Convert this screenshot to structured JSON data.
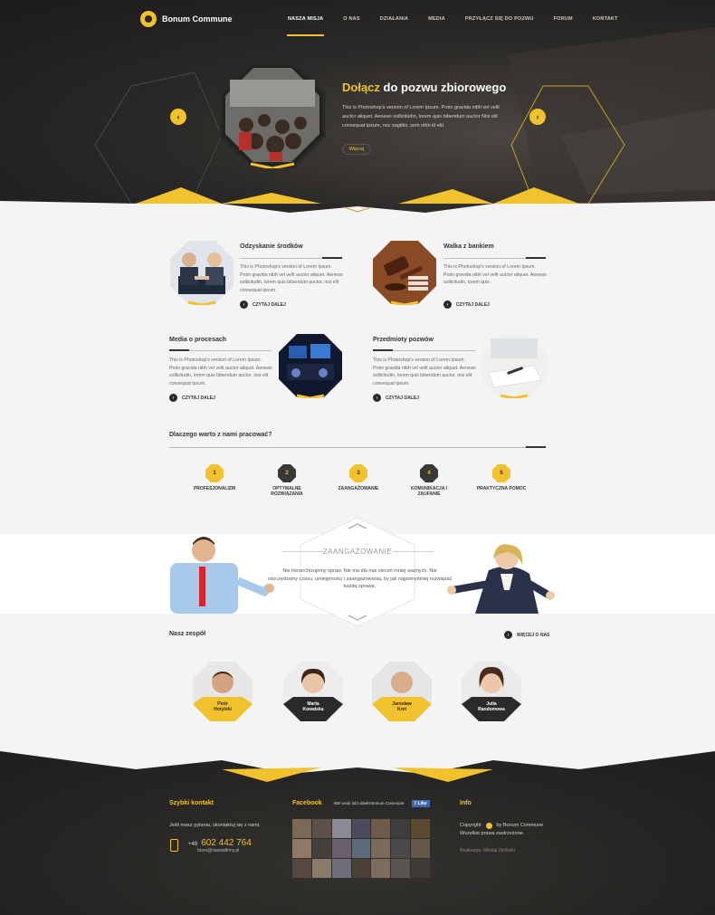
{
  "brand": {
    "name": "Bonum Commune",
    "accent": "#f2c12e",
    "dark": "#2b2a28"
  },
  "nav": [
    {
      "label": "NASZA MISJA",
      "active": true
    },
    {
      "label": "O NAS"
    },
    {
      "label": "DZIAŁANIA"
    },
    {
      "label": "MEDIA"
    },
    {
      "label": "PRZYŁĄCZ SIĘ DO POZWU"
    },
    {
      "label": "FORUM"
    },
    {
      "label": "KONTAKT"
    }
  ],
  "hero": {
    "title_accent": "Dołącz",
    "title_rest": " do pozwu zbiorowego",
    "text": "This is Photoshop's version  of Lorem Ipsum. Proin gravida nibh vel velit auctor aliquet. Aenean sollicitudin, lorem quis bibendum auctor Nisi elit consequat ipsum, nec sagittis, sem nibh id elit.",
    "button": "Więcej",
    "prev_icon": "chevron-left-icon",
    "next_icon": "chevron-right-icon"
  },
  "services": [
    {
      "title": "Odzyskanie środków",
      "text": "This is Photoshop's version  of Lorem Ipsum. Proin gravida nibh vel velit auctor aliquet. Aenean sollicitudin, lorem quis bibendum auctor, nisi elit consequat ipsum.",
      "link": "CZYTAJ DALEJ"
    },
    {
      "title": "Walka z bankiem",
      "text": "This is Photoshop's version  of Lorem Ipsum. Proin gravida nibh vel velit auctor aliquet. Aenean sollicitudin, lorem quis.",
      "link": "CZYTAJ DALEJ"
    },
    {
      "title": "Media o procesach",
      "text": "This is Photoshop's version  of Lorem Ipsum. Proin gravida nibh vel velit auctor aliquet. Aenean sollicitudin, lorem quis bibendum auctor, nisi elit consequat ipsum.",
      "link": "CZYTAJ DALEJ"
    },
    {
      "title": "Przedmioty pozwów",
      "text": "This is Photoshop's version  of Lorem Ipsum. Proin gravida nibh vel velit auctor aliquet. Aenean sollicitudin, lorem quis bibendum auctor, nisi elit consequat ipsum.",
      "link": "CZYTAJ DALEJ"
    }
  ],
  "why": {
    "title": "Dlaczego warto z nami pracować?",
    "items": [
      {
        "num": "1",
        "label": "PROFESJONALIZM"
      },
      {
        "num": "2",
        "label": "OPTYMALNE ROZWIĄZANIA"
      },
      {
        "num": "3",
        "label": "ZAANGAŻOWANIE"
      },
      {
        "num": "4",
        "label": "KOMUNIKACJA I ZAUFANIE"
      },
      {
        "num": "5",
        "label": "PRAKTYCZNA POMOC"
      }
    ]
  },
  "commitment": {
    "heading": "ZAANGAŻOWANIE",
    "text": "Nie hierarchizujemy spraw. Nie ma dla nas zleceń mniej ważnych. Nie oszczędzamy czasu, umiejętności i zaangażowania, by jak najpomyślniej rozwiązać każdą sprawę."
  },
  "team": {
    "title": "Nasz zespół",
    "more": "WIĘCEJ O NAS",
    "members": [
      {
        "first": "Piotr",
        "last": "Hotylski"
      },
      {
        "first": "Marta",
        "last": "Kowalska"
      },
      {
        "first": "Jarosław",
        "last": "Kret"
      },
      {
        "first": "Julia",
        "last": "Randomowa"
      }
    ]
  },
  "footer": {
    "contact": {
      "title": "Szybki kontakt",
      "text": "Jeśli masz pytania, skontaktuj się z nami.",
      "prefix": "+48",
      "phone": "602 442 764",
      "email": "biuro@nazwafirmy.pl"
    },
    "facebook": {
      "title": "Facebook",
      "likes_text": "650 osób lubi obiekt Bonum Commune",
      "like_button": "Like"
    },
    "info": {
      "title": "Info",
      "copyright": "Copyright",
      "by": "by Bonum Commune",
      "rights": "Wszelkie prawa zastrzeżone.",
      "credit": "Realizacja: Mikołaj Zieliński"
    }
  }
}
